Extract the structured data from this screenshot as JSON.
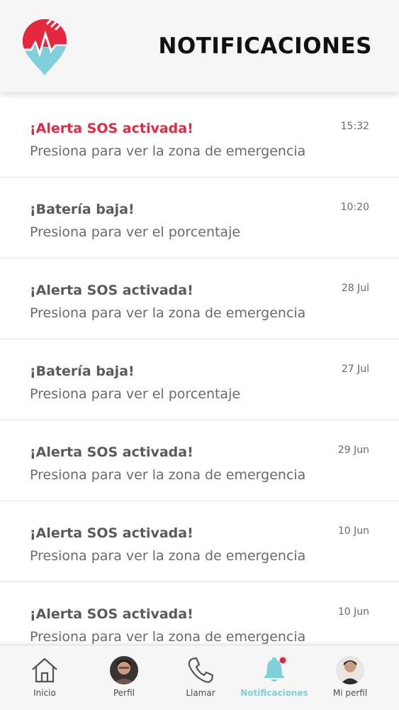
{
  "header": {
    "title": "NOTIFICACIONES",
    "logo_icon": "heart-pulse-pin-logo",
    "colors": {
      "logo_red": "#e5283f",
      "logo_teal": "#7fd0da"
    }
  },
  "notifications": [
    {
      "title": "¡Alerta SOS activada!",
      "subtitle": "Presiona para ver la zona de emergencia",
      "time": "15:32",
      "highlight": true
    },
    {
      "title": "¡Batería baja!",
      "subtitle": "Presiona para ver el porcentaje",
      "time": "10:20",
      "highlight": false
    },
    {
      "title": "¡Alerta SOS activada!",
      "subtitle": "Presiona para ver la zona de emergencia",
      "time": "28 Jul",
      "highlight": false
    },
    {
      "title": "¡Batería baja!",
      "subtitle": "Presiona para ver el porcentaje",
      "time": "27 Jul",
      "highlight": false
    },
    {
      "title": "¡Alerta SOS activada!",
      "subtitle": "Presiona para ver la zona de emergencia",
      "time": "29 Jun",
      "highlight": false
    },
    {
      "title": "¡Alerta SOS activada!",
      "subtitle": "Presiona para ver la zona de emergencia",
      "time": "10 Jun",
      "highlight": false
    },
    {
      "title": "¡Alerta SOS activada!",
      "subtitle": "Presiona para ver la zona de emergencia",
      "time": "10 Jun",
      "highlight": false
    }
  ],
  "tabbar": {
    "tabs": [
      {
        "label": "Inicio",
        "icon": "home-icon"
      },
      {
        "label": "Perfil",
        "icon": "profile-avatar"
      },
      {
        "label": "Llamar",
        "icon": "phone-icon"
      },
      {
        "label": "Notificaciones",
        "icon": "bell-icon",
        "active": true
      },
      {
        "label": "Mi perfil",
        "icon": "my-profile-avatar"
      }
    ],
    "active_color": "#7fd0da",
    "badge_color": "#e5283f"
  }
}
